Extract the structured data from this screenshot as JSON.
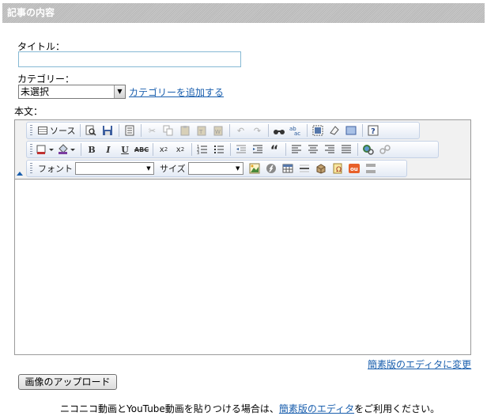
{
  "section_title": "記事の内容",
  "title_label": "タイトル：",
  "title_value": "",
  "category_label": "カテゴリー：",
  "category_selected": "未選択",
  "add_category_link": "カテゴリーを追加する",
  "body_label": "本文：",
  "toolbar": {
    "source_label": "ソース",
    "font_label": "フォント",
    "size_label": "サイズ",
    "font_value": "",
    "size_value": ""
  },
  "switch_editor_link": "簡素版のエディタに変更",
  "upload_button": "画像のアップロード",
  "note": {
    "prefix": "ニコニコ動画とYouTube動画を貼りつける場合は、",
    "link": "簡素版のエディタ",
    "suffix": "をご利用ください。"
  }
}
